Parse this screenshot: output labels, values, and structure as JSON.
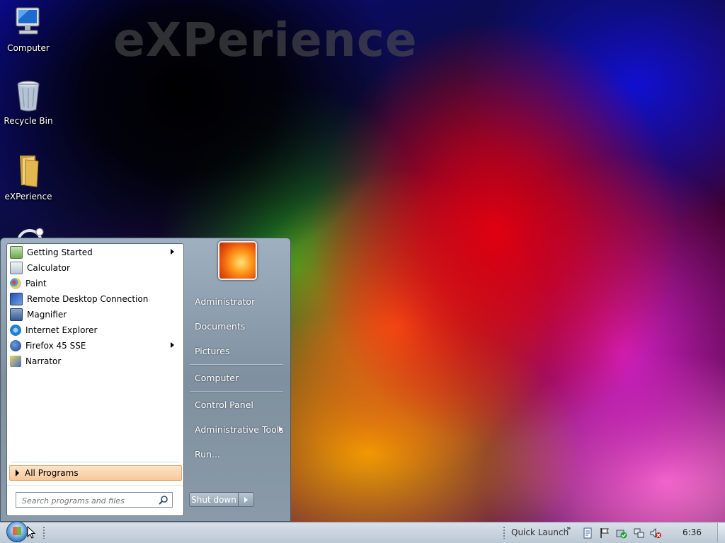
{
  "desktop": {
    "watermark": "eXPerience",
    "icons": [
      {
        "label": "Computer",
        "icon": "computer-icon"
      },
      {
        "label": "Recycle Bin",
        "icon": "recycle-bin-icon"
      },
      {
        "label": "eXPerience",
        "icon": "folder-icon"
      }
    ]
  },
  "start_menu": {
    "programs": [
      {
        "label": "Getting Started",
        "icon": "getting-started-icon",
        "submenu": true
      },
      {
        "label": "Calculator",
        "icon": "calculator-icon",
        "submenu": false
      },
      {
        "label": "Paint",
        "icon": "paint-icon",
        "submenu": false
      },
      {
        "label": "Remote Desktop Connection",
        "icon": "remote-desktop-icon",
        "submenu": false
      },
      {
        "label": "Magnifier",
        "icon": "magnifier-icon",
        "submenu": false
      },
      {
        "label": "Internet Explorer",
        "icon": "internet-explorer-icon",
        "submenu": false
      },
      {
        "label": "Firefox 45 SSE",
        "icon": "firefox-icon",
        "submenu": true
      },
      {
        "label": "Narrator",
        "icon": "narrator-icon",
        "submenu": false
      }
    ],
    "all_programs": "All Programs",
    "search_placeholder": "Search programs and files",
    "right": {
      "user": "Administrator",
      "documents": "Documents",
      "pictures": "Pictures",
      "computer": "Computer",
      "control_panel": "Control Panel",
      "admin_tools": "Administrative Tools",
      "run": "Run..."
    },
    "shutdown": "Shut down"
  },
  "taskbar": {
    "quick_launch": "Quick Launch",
    "chevron": "»",
    "clock": "6:36"
  },
  "colors": {
    "taskbar": "#c8d2dc",
    "start_menu": "#8e9eae",
    "all_programs_highlight": "#f8c89a"
  }
}
